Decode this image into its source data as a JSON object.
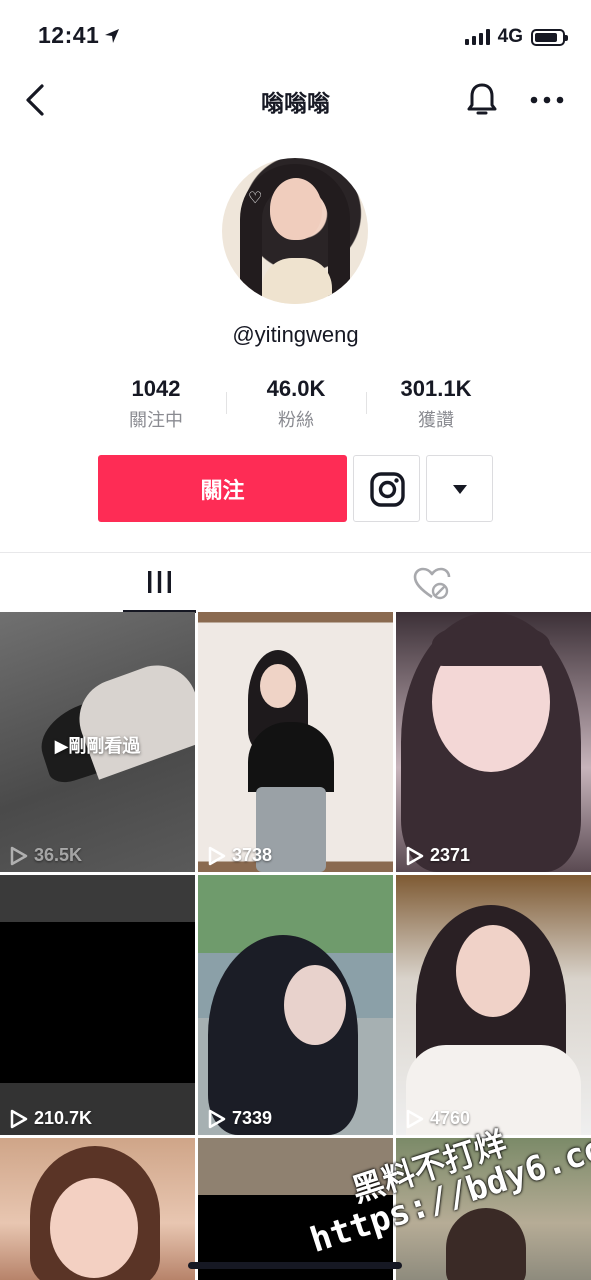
{
  "status_bar": {
    "time": "12:41",
    "network": "4G",
    "battery_level": 0.85
  },
  "nav": {
    "title": "嗡嗡嗡"
  },
  "profile": {
    "username": "@yitingweng",
    "stats": [
      {
        "value": "1042",
        "label": "關注中"
      },
      {
        "value": "46.0K",
        "label": "粉絲"
      },
      {
        "value": "301.1K",
        "label": "獲讚"
      }
    ],
    "follow_label": "關注"
  },
  "tabs": {
    "videos_icon": "grid-bars-icon",
    "liked_icon": "hidden-heart-icon"
  },
  "videos": [
    {
      "views": "36.5K",
      "watched_label": "▶剛剛看過"
    },
    {
      "views": "3738"
    },
    {
      "views": "2371"
    },
    {
      "views": "210.7K"
    },
    {
      "views": "7339"
    },
    {
      "views": "4760"
    },
    {
      "views": ""
    },
    {
      "views": ""
    },
    {
      "views": ""
    }
  ],
  "watermark": {
    "line1": "黑料不打烊",
    "line2": "https://bdy6.co"
  },
  "colors": {
    "accent": "#fe2c55",
    "text": "#161823",
    "muted": "#8a8b91"
  }
}
